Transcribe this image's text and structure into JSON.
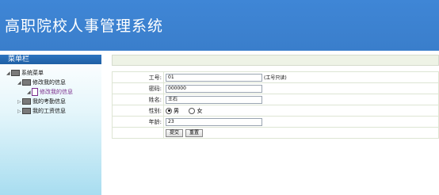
{
  "header": {
    "title": "高职院校人事管理系统"
  },
  "sidebar": {
    "heading": "菜单栏",
    "items": [
      {
        "label": "系统菜单"
      },
      {
        "label": "修改我的信息"
      },
      {
        "label": "修改我的信息"
      },
      {
        "label": "我的考勤信息"
      },
      {
        "label": "我的工资信息"
      }
    ]
  },
  "form": {
    "id_label": "工号:",
    "id_value": "01",
    "id_note": "(工号只读)",
    "password_label": "密码:",
    "password_value": "000000",
    "name_label": "姓名:",
    "name_value": "王石",
    "gender_label": "性别:",
    "gender_male": "男",
    "gender_female": "女",
    "age_label": "年龄:",
    "age_value": "23",
    "submit_label": "提交",
    "reset_label": "重置"
  }
}
